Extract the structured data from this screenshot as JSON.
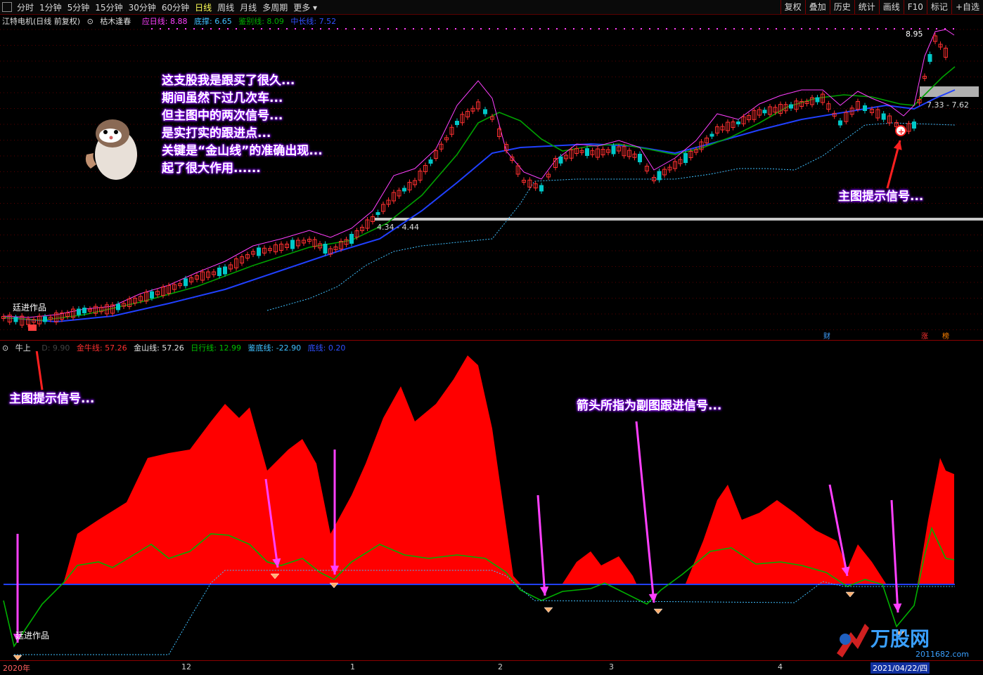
{
  "toolbar": {
    "periods": [
      "分时",
      "1分钟",
      "5分钟",
      "15分钟",
      "30分钟",
      "60分钟",
      "日线",
      "周线",
      "月线",
      "多周期",
      "更多"
    ],
    "active": "日线",
    "right_buttons": [
      "复权",
      "叠加",
      "历史",
      "统计",
      "画线",
      "F10",
      "标记",
      "+自选"
    ]
  },
  "main_legend": {
    "title": "江特电机(日线 前复权)",
    "indicator": "枯木逢春",
    "items": [
      {
        "label": "应日线: 8.88",
        "color": "#ff40ff"
      },
      {
        "label": "底撑: 6.65",
        "color": "#40c0ff"
      },
      {
        "label": "鉴别线: 8.09",
        "color": "#00b000"
      },
      {
        "label": "中长线: 7.52",
        "color": "#3050ff"
      }
    ]
  },
  "sub_legend": {
    "indicator": "牛上",
    "hidden_label": "D: 9.90",
    "items": [
      {
        "label": "金牛线: 57.26",
        "color": "#ff3030"
      },
      {
        "label": "金山线: 57.26",
        "color": "#e0e0e0"
      },
      {
        "label": "日行线: 12.99",
        "color": "#00c000"
      },
      {
        "label": "鉴底线: -22.90",
        "color": "#40c0ff"
      },
      {
        "label": "底线: 0.20",
        "color": "#3050ff"
      }
    ]
  },
  "annotations": {
    "main_text": [
      "这支股我是跟买了很久...",
      "期间虽然下过几次车...",
      "但主图中的两次信号...",
      "是实打实的跟进点...",
      "关键是“金山线”的准确出现...",
      "起了很大作用......"
    ],
    "main_signal_right": "主图提示信号...",
    "main_signal_left": "主图提示信号...",
    "sub_signal": "箭头所指为副图跟进信号...",
    "author_top": "廷进作品",
    "author_bottom": "廷进作品"
  },
  "price_labels": {
    "high": "8.95",
    "range_right": "7.33 - 7.62",
    "range_left": "4.34 - 4.44"
  },
  "badges": {
    "cai": "财",
    "zhang": "涨",
    "lu": "榜"
  },
  "x_axis": [
    "2020年",
    "12",
    "1",
    "2",
    "3",
    "4"
  ],
  "date_tag": "2021/04/22/四",
  "watermark": {
    "text": "万股网",
    "url": "2011682.com"
  },
  "colors": {
    "up": "#ff3030",
    "down": "#00c8c8",
    "ma_green": "#00a000",
    "ma_blue": "#2040ff",
    "ma_magenta": "#ff40ff",
    "area_red": "#ff0000",
    "arrow": "#ff40ff"
  }
}
